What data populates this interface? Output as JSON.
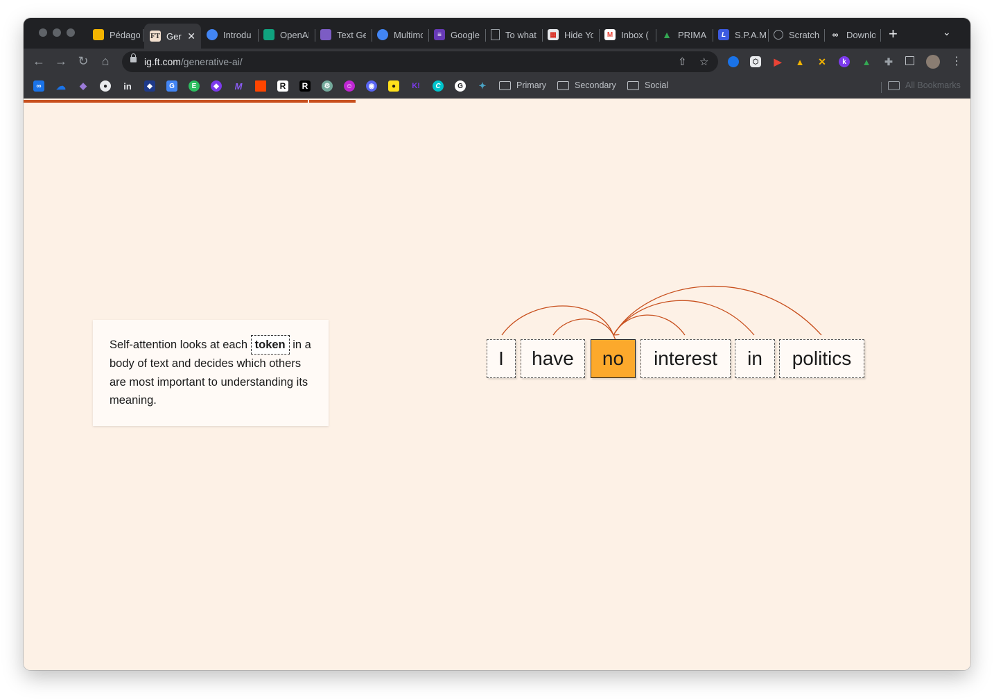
{
  "browser": {
    "tabs": [
      {
        "title": "Pédago",
        "icon": "slides-icon",
        "color": "#f4b400"
      },
      {
        "title": "Ger",
        "icon": "ft-icon",
        "color": "#f2dfce",
        "active": true
      },
      {
        "title": "Introdu",
        "icon": "google-cloud-icon",
        "color": "#4285f4"
      },
      {
        "title": "OpenAI",
        "icon": "openai-icon",
        "color": "#10a37f"
      },
      {
        "title": "Text Ge",
        "icon": "obsidian-icon",
        "color": "#7c5cc4"
      },
      {
        "title": "Multimo",
        "icon": "google-cloud-icon",
        "color": "#4285f4"
      },
      {
        "title": "Google",
        "icon": "forms-icon",
        "color": "#673ab7"
      },
      {
        "title": "To what",
        "icon": "document-icon",
        "color": "#9aa0a6"
      },
      {
        "title": "Hide Yo",
        "icon": "calendar-icon",
        "color": "#e8eaed"
      },
      {
        "title": "Inbox (",
        "icon": "gmail-icon",
        "color": "#ea4335"
      },
      {
        "title": "PRIMAI",
        "icon": "google-drive-icon",
        "color": "#34a853"
      },
      {
        "title": "S.P.A.M",
        "icon": "l-icon",
        "color": "#3c5ae0"
      },
      {
        "title": "Scratch",
        "icon": "scratch-icon",
        "color": "#9aa0a6"
      },
      {
        "title": "Downlo",
        "icon": "download-icon",
        "color": "#e8eaed"
      }
    ],
    "close_symbol": "✕",
    "new_tab_symbol": "+",
    "tab_menu_symbol": "⌄",
    "url_host": "ig.ft.com",
    "url_path": "/generative-ai/",
    "bookmark_folders": [
      "Primary",
      "Secondary",
      "Social"
    ],
    "all_bookmarks_label": "All Bookmarks",
    "bookmark_icons": [
      {
        "name": "infinity-icon",
        "color": "#1a73e8",
        "glyph": "∞"
      },
      {
        "name": "cloud-icon",
        "color": "#1a73e8",
        "glyph": "☁"
      },
      {
        "name": "obsidian-icon",
        "color": "#7c5cc4",
        "glyph": "◆"
      },
      {
        "name": "github-icon",
        "color": "#202124",
        "glyph": "●"
      },
      {
        "name": "linkedin-icon",
        "color": "#0a66c2",
        "glyph": "in"
      },
      {
        "name": "cube-icon",
        "color": "#1e3a8a",
        "glyph": "◆"
      },
      {
        "name": "translate-icon",
        "color": "#4285f4",
        "glyph": "G"
      },
      {
        "name": "evernote-icon",
        "color": "#2dbe60",
        "glyph": "E"
      },
      {
        "name": "diamond-icon",
        "color": "#7c3aed",
        "glyph": "◆"
      },
      {
        "name": "make-icon",
        "color": "#6d28d9",
        "glyph": "M"
      },
      {
        "name": "square-icon",
        "color": "#ff4500",
        "glyph": ""
      },
      {
        "name": "r-icon",
        "color": "#111111",
        "glyph": "R"
      },
      {
        "name": "r-dark-icon",
        "color": "#000000",
        "glyph": "R"
      },
      {
        "name": "chatgpt-icon",
        "color": "#74aa9c",
        "glyph": "⚙"
      },
      {
        "name": "bot-icon",
        "color": "#c026d3",
        "glyph": "☺"
      },
      {
        "name": "discord-icon",
        "color": "#5865f2",
        "glyph": "◉"
      },
      {
        "name": "mailchimp-icon",
        "color": "#ffe01b",
        "glyph": "●"
      },
      {
        "name": "kahoot-icon",
        "color": "#46178f",
        "glyph": "K!"
      },
      {
        "name": "canva-icon",
        "color": "#00c4cc",
        "glyph": "C"
      },
      {
        "name": "grammarly-icon",
        "color": "#202124",
        "glyph": "G"
      },
      {
        "name": "sparkle-icon",
        "color": "#35363a",
        "glyph": "✦"
      }
    ]
  },
  "progress": {
    "segment_1": 1.0,
    "segment_2": 0.14
  },
  "info_card": {
    "before": "Self-attention looks at each ",
    "token": "token",
    "after": " in a body of text and decides which others are most important to understanding its meaning."
  },
  "tokens": [
    {
      "text": "I",
      "highlighted": false
    },
    {
      "text": "have",
      "highlighted": false
    },
    {
      "text": "no",
      "highlighted": true
    },
    {
      "text": "interest",
      "highlighted": false
    },
    {
      "text": "in",
      "highlighted": false
    },
    {
      "text": "politics",
      "highlighted": false
    }
  ],
  "colors": {
    "accent": "#c8501e",
    "highlight": "#fca92c",
    "background": "#fdf1e6"
  }
}
